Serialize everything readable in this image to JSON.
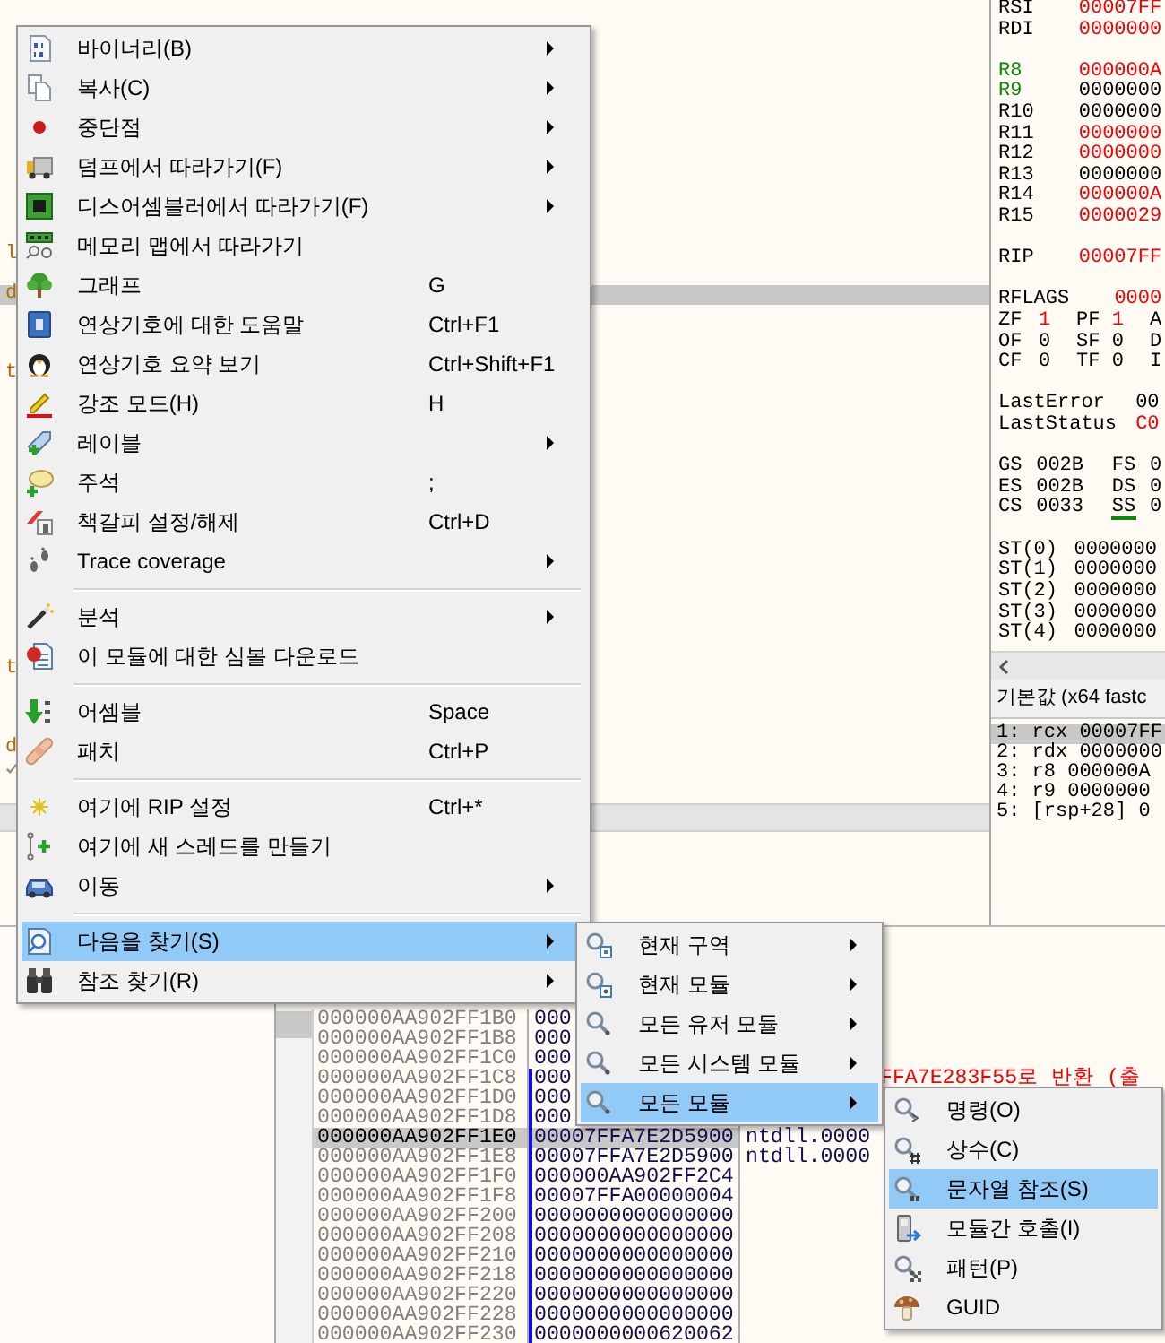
{
  "disassembly": {
    "fragments": [
      {
        "text": "l",
        "selected": false
      },
      {
        "text": "d",
        "selected": true
      },
      {
        "text": "t",
        "selected": false
      },
      {
        "text": "t",
        "selected": false
      },
      {
        "text": "d",
        "selected": false
      }
    ]
  },
  "registers": {
    "groups": [
      [
        {
          "kind": "reg",
          "tokens": [
            {
              "text": "RSI",
              "kind": "plain"
            },
            {
              "text": "00007FF",
              "kind": "changed"
            }
          ]
        },
        {
          "kind": "reg",
          "tokens": [
            {
              "text": "RDI",
              "kind": "plain"
            },
            {
              "text": "0000000",
              "kind": "changed"
            }
          ]
        }
      ],
      [
        {
          "kind": "reg",
          "tokens": [
            {
              "text": "R8",
              "kind": "modified"
            },
            {
              "text": "000000A",
              "kind": "changed"
            }
          ]
        },
        {
          "kind": "reg",
          "tokens": [
            {
              "text": "R9",
              "kind": "modified"
            },
            {
              "text": "0000000",
              "kind": "plain"
            }
          ]
        },
        {
          "kind": "reg",
          "tokens": [
            {
              "text": "R10",
              "kind": "plain"
            },
            {
              "text": "0000000",
              "kind": "plain"
            }
          ]
        },
        {
          "kind": "reg",
          "tokens": [
            {
              "text": "R11",
              "kind": "plain"
            },
            {
              "text": "0000000",
              "kind": "changed"
            }
          ]
        },
        {
          "kind": "reg",
          "tokens": [
            {
              "text": "R12",
              "kind": "plain"
            },
            {
              "text": "0000000",
              "kind": "changed"
            }
          ]
        },
        {
          "kind": "reg",
          "tokens": [
            {
              "text": "R13",
              "kind": "plain"
            },
            {
              "text": "0000000",
              "kind": "plain"
            }
          ]
        },
        {
          "kind": "reg",
          "tokens": [
            {
              "text": "R14",
              "kind": "plain"
            },
            {
              "text": "000000A",
              "kind": "changed"
            }
          ]
        },
        {
          "kind": "reg",
          "tokens": [
            {
              "text": "R15",
              "kind": "plain"
            },
            {
              "text": "0000029",
              "kind": "changed"
            }
          ]
        }
      ],
      [
        {
          "kind": "reg",
          "tokens": [
            {
              "text": "RIP",
              "kind": "plain"
            },
            {
              "text": "00007FF",
              "kind": "changed"
            }
          ]
        }
      ],
      [
        {
          "kind": "rflags",
          "tokens": [
            {
              "text": "RFLAGS",
              "kind": "plain"
            },
            {
              "text": "0000",
              "kind": "changed"
            }
          ]
        },
        {
          "kind": "flags",
          "tokens": [
            {
              "text": "ZF",
              "kind": "plain"
            },
            {
              "text": "1",
              "kind": "changed"
            },
            {
              "text": "PF",
              "kind": "plain"
            },
            {
              "text": "1",
              "kind": "changed"
            },
            {
              "text": "A",
              "kind": "plain"
            }
          ]
        },
        {
          "kind": "flags",
          "tokens": [
            {
              "text": "OF",
              "kind": "plain"
            },
            {
              "text": "0",
              "kind": "plain"
            },
            {
              "text": "SF",
              "kind": "plain"
            },
            {
              "text": "0",
              "kind": "plain"
            },
            {
              "text": "D",
              "kind": "plain"
            }
          ]
        },
        {
          "kind": "flags",
          "tokens": [
            {
              "text": "CF",
              "kind": "plain"
            },
            {
              "text": "0",
              "kind": "plain"
            },
            {
              "text": "TF",
              "kind": "plain"
            },
            {
              "text": "0",
              "kind": "plain"
            },
            {
              "text": "I",
              "kind": "plain"
            }
          ]
        }
      ],
      [
        {
          "kind": "status",
          "tokens": [
            {
              "text": "LastError",
              "kind": "plain"
            },
            {
              "text": "00",
              "kind": "plain"
            }
          ]
        },
        {
          "kind": "status",
          "tokens": [
            {
              "text": "LastStatus",
              "kind": "plain"
            },
            {
              "text": "C0",
              "kind": "changed"
            }
          ]
        }
      ],
      [
        {
          "kind": "seg",
          "tokens": [
            {
              "text": "GS",
              "kind": "plain"
            },
            {
              "text": "002B",
              "kind": "plain"
            },
            {
              "text": "FS",
              "kind": "plain"
            },
            {
              "text": "0",
              "kind": "plain"
            }
          ]
        },
        {
          "kind": "seg",
          "tokens": [
            {
              "text": "ES",
              "kind": "plain"
            },
            {
              "text": "002B",
              "kind": "plain"
            },
            {
              "text": "DS",
              "kind": "plain"
            },
            {
              "text": "0",
              "kind": "plain"
            }
          ]
        },
        {
          "kind": "seg",
          "tokens": [
            {
              "text": "CS",
              "kind": "plain"
            },
            {
              "text": "0033",
              "kind": "plain"
            },
            {
              "text": "SS",
              "kind": "underlined"
            },
            {
              "text": "0",
              "kind": "plain"
            }
          ]
        }
      ],
      [
        {
          "kind": "fpu",
          "tokens": [
            {
              "text": "ST(0)",
              "kind": "plain"
            },
            {
              "text": "0000000",
              "kind": "plain"
            }
          ]
        },
        {
          "kind": "fpu",
          "tokens": [
            {
              "text": "ST(1)",
              "kind": "plain"
            },
            {
              "text": "0000000",
              "kind": "plain"
            }
          ]
        },
        {
          "kind": "fpu",
          "tokens": [
            {
              "text": "ST(2)",
              "kind": "plain"
            },
            {
              "text": "0000000",
              "kind": "plain"
            }
          ]
        },
        {
          "kind": "fpu",
          "tokens": [
            {
              "text": "ST(3)",
              "kind": "plain"
            },
            {
              "text": "0000000",
              "kind": "plain"
            }
          ]
        },
        {
          "kind": "fpu",
          "tokens": [
            {
              "text": "ST(4)",
              "kind": "plain"
            },
            {
              "text": "0000000",
              "kind": "plain"
            }
          ]
        }
      ]
    ]
  },
  "arguments": {
    "header": "기본값 (x64 fastc",
    "rows": [
      {
        "text": "1: rcx 00007FF",
        "selected": true
      },
      {
        "text": "2: rdx 0000000",
        "selected": false
      },
      {
        "text": "3: r8 000000A",
        "selected": false
      },
      {
        "text": "4: r9 0000000",
        "selected": false
      },
      {
        "text": "5: [rsp+28] 0",
        "selected": false
      }
    ]
  },
  "stack": {
    "rows": [
      {
        "address": "000000AA902FF1B0",
        "value": "000",
        "selected": false,
        "frame": false
      },
      {
        "address": "000000AA902FF1B8",
        "value": "000",
        "selected": false,
        "frame": false
      },
      {
        "address": "000000AA902FF1C0",
        "value": "000",
        "selected": false,
        "frame": false
      },
      {
        "address": "000000AA902FF1C8",
        "value": "000",
        "comment": {
          "text": "FFA7E283F55로 반환 (출",
          "kind": "return"
        },
        "selected": false,
        "frame": true
      },
      {
        "address": "000000AA902FF1D0",
        "value": "000",
        "selected": false,
        "frame": true
      },
      {
        "address": "000000AA902FF1D8",
        "value": "000",
        "selected": false,
        "frame": true
      },
      {
        "address": "000000AA902FF1E0",
        "value": "00007FFA7E2D5900",
        "comment": {
          "text": "ntdll.0000",
          "kind": "plain"
        },
        "selected": true,
        "frame": true
      },
      {
        "address": "000000AA902FF1E8",
        "value": "00007FFA7E2D5900",
        "comment": {
          "text": "ntdll.0000",
          "kind": "plain"
        },
        "selected": false,
        "frame": true
      },
      {
        "address": "000000AA902FF1F0",
        "value": "000000AA902FF2C4",
        "selected": false,
        "frame": true
      },
      {
        "address": "000000AA902FF1F8",
        "value": "00007FFA00000004",
        "selected": false,
        "frame": true
      },
      {
        "address": "000000AA902FF200",
        "value": "0000000000000000",
        "selected": false,
        "frame": true
      },
      {
        "address": "000000AA902FF208",
        "value": "0000000000000000",
        "selected": false,
        "frame": true
      },
      {
        "address": "000000AA902FF210",
        "value": "0000000000000000",
        "selected": false,
        "frame": true
      },
      {
        "address": "000000AA902FF218",
        "value": "0000000000000000",
        "selected": false,
        "frame": true
      },
      {
        "address": "000000AA902FF220",
        "value": "0000000000000000",
        "selected": false,
        "frame": true
      },
      {
        "address": "000000AA902FF228",
        "value": "0000000000000000",
        "selected": false,
        "frame": true
      },
      {
        "address": "000000AA902FF230",
        "value": "0000000000620062",
        "selected": false,
        "frame": true
      }
    ]
  },
  "context_menu": {
    "items": [
      {
        "kind": "item",
        "label": "바이너리(B)",
        "has_submenu": true,
        "selected": false
      },
      {
        "kind": "item",
        "label": "복사(C)",
        "has_submenu": true,
        "selected": false
      },
      {
        "kind": "item",
        "label": "중단점",
        "has_submenu": true,
        "selected": false
      },
      {
        "kind": "item",
        "label": "덤프에서 따라가기(F)",
        "has_submenu": true,
        "selected": false
      },
      {
        "kind": "item",
        "label": "디스어셈블러에서 따라가기(F)",
        "has_submenu": true,
        "selected": false
      },
      {
        "kind": "item",
        "label": "메모리 맵에서 따라가기",
        "has_submenu": false,
        "selected": false
      },
      {
        "kind": "item",
        "label": "그래프",
        "shortcut": "G",
        "has_submenu": false,
        "selected": false
      },
      {
        "kind": "item",
        "label": "연상기호에 대한 도움말",
        "shortcut": "Ctrl+F1",
        "has_submenu": false,
        "selected": false
      },
      {
        "kind": "item",
        "label": "연상기호 요약 보기",
        "shortcut": "Ctrl+Shift+F1",
        "has_submenu": false,
        "selected": false
      },
      {
        "kind": "item",
        "label": "강조 모드(H)",
        "shortcut": "H",
        "has_submenu": false,
        "selected": false
      },
      {
        "kind": "item",
        "label": "레이블",
        "has_submenu": true,
        "selected": false
      },
      {
        "kind": "item",
        "label": "주석",
        "shortcut": ";",
        "has_submenu": false,
        "selected": false
      },
      {
        "kind": "item",
        "label": "책갈피 설정/해제",
        "shortcut": "Ctrl+D",
        "has_submenu": false,
        "selected": false
      },
      {
        "kind": "item",
        "label": "Trace coverage",
        "has_submenu": true,
        "selected": false
      },
      {
        "kind": "separator"
      },
      {
        "kind": "item",
        "label": "분석",
        "has_submenu": true,
        "selected": false
      },
      {
        "kind": "item",
        "label": "이 모듈에 대한 심볼 다운로드",
        "has_submenu": false,
        "selected": false
      },
      {
        "kind": "separator"
      },
      {
        "kind": "item",
        "label": "어셈블",
        "shortcut": "Space",
        "has_submenu": false,
        "selected": false
      },
      {
        "kind": "item",
        "label": "패치",
        "shortcut": "Ctrl+P",
        "has_submenu": false,
        "selected": false
      },
      {
        "kind": "separator"
      },
      {
        "kind": "item",
        "label": "여기에 RIP 설정",
        "shortcut": "Ctrl+*",
        "has_submenu": false,
        "selected": false
      },
      {
        "kind": "item",
        "label": "여기에 새 스레드를 만들기",
        "has_submenu": false,
        "selected": false
      },
      {
        "kind": "item",
        "label": "이동",
        "has_submenu": true,
        "selected": false
      },
      {
        "kind": "separator"
      },
      {
        "kind": "item",
        "label": "다음을 찾기(S)",
        "has_submenu": true,
        "selected": true
      },
      {
        "kind": "item",
        "label": "참조 찾기(R)",
        "has_submenu": true,
        "selected": false
      }
    ]
  },
  "search_submenu": {
    "items": [
      {
        "label": "현재 구역",
        "has_submenu": true,
        "selected": false
      },
      {
        "label": "현재 모듈",
        "has_submenu": true,
        "selected": false
      },
      {
        "label": "모든 유저 모듈",
        "has_submenu": true,
        "selected": false
      },
      {
        "label": "모든 시스템 모듈",
        "has_submenu": true,
        "selected": false
      },
      {
        "label": "모든 모듈",
        "has_submenu": true,
        "selected": true
      }
    ]
  },
  "module_submenu": {
    "items": [
      {
        "label": "명령(O)",
        "selected": false
      },
      {
        "label": "상수(C)",
        "selected": false
      },
      {
        "label": "문자열 참조(S)",
        "selected": true
      },
      {
        "label": "모듈간 호출(I)",
        "selected": false
      },
      {
        "label": "패턴(P)",
        "selected": false
      },
      {
        "label": "GUID",
        "selected": false
      }
    ]
  }
}
